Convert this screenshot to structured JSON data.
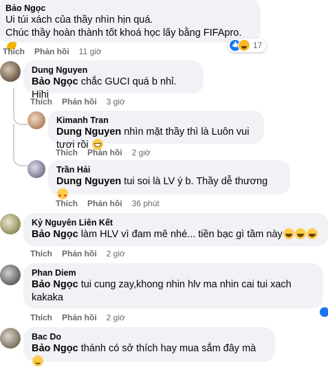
{
  "comments": [
    {
      "author": "Bảo Ngọc",
      "lines": [
        "Ui túi xách của thầy nhìn hịn quá.",
        "Chúc thầy hoàn thành tốt khoá học lấy bằng FIFApro."
      ],
      "like": "Thích",
      "reply": "Phản hồi",
      "time": "11 giờ",
      "reaction_count": "17"
    },
    {
      "author": "Dung Nguyen",
      "mention": "Bảo Ngọc",
      "text": "chắc GUCI quá b nhỉ. Hihi",
      "like": "Thích",
      "reply": "Phản hồi",
      "time": "3 giờ"
    },
    {
      "author": "Kimanh Tran",
      "mention": "Dung Nguyen",
      "text": "nhìn mặt thầy thì là Luôn vui tươi rồi",
      "like": "Thích",
      "reply": "Phản hồi",
      "time": "2 giờ"
    },
    {
      "author": "Trần Hải",
      "mention": "Dung Nguyen",
      "text": "tui soi là LV ý b. Thầy dễ thương",
      "like": "Thích",
      "reply": "Phản hồi",
      "time": "36 phút"
    },
    {
      "author": "Kỷ Nguyên Liên Kết",
      "mention": "Bảo Ngọc",
      "text": "làm HLV vì đam mê nhé... tiền bạc gì tầm này",
      "like": "Thích",
      "reply": "Phản hồi",
      "time": "2 giờ"
    },
    {
      "author": "Phan Diem",
      "mention": "Bảo Ngọc",
      "text": "tui cung zay,khong nhin hlv ma nhin cai tui xach",
      "text2": "kakaka",
      "like": "Thích",
      "reply": "Phản hồi",
      "time": "2 giờ"
    },
    {
      "author": "Bac Do",
      "mention": "Bảo Ngọc",
      "text": "thánh có sở thích hay mua sắm đây mà"
    }
  ],
  "colors": {
    "bubble": "#f0f2f5",
    "meta": "#65676b",
    "accent": "#1877f2"
  }
}
